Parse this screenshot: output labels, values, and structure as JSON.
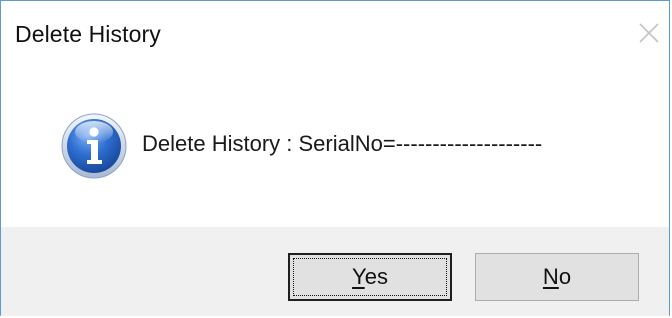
{
  "window": {
    "title": "Delete History",
    "close_icon": "close-icon"
  },
  "content": {
    "icon": "info-icon",
    "message": "Delete History : SerialNo=--------------------"
  },
  "buttons": {
    "yes": {
      "mnemonic": "Y",
      "rest": "es"
    },
    "no": {
      "mnemonic": "N",
      "rest": "o"
    }
  },
  "colors": {
    "icon_blue": "#2f6fd1",
    "footer_bg": "#f0f0f0",
    "button_bg": "#e1e1e1",
    "window_border": "#5b9bd5"
  }
}
